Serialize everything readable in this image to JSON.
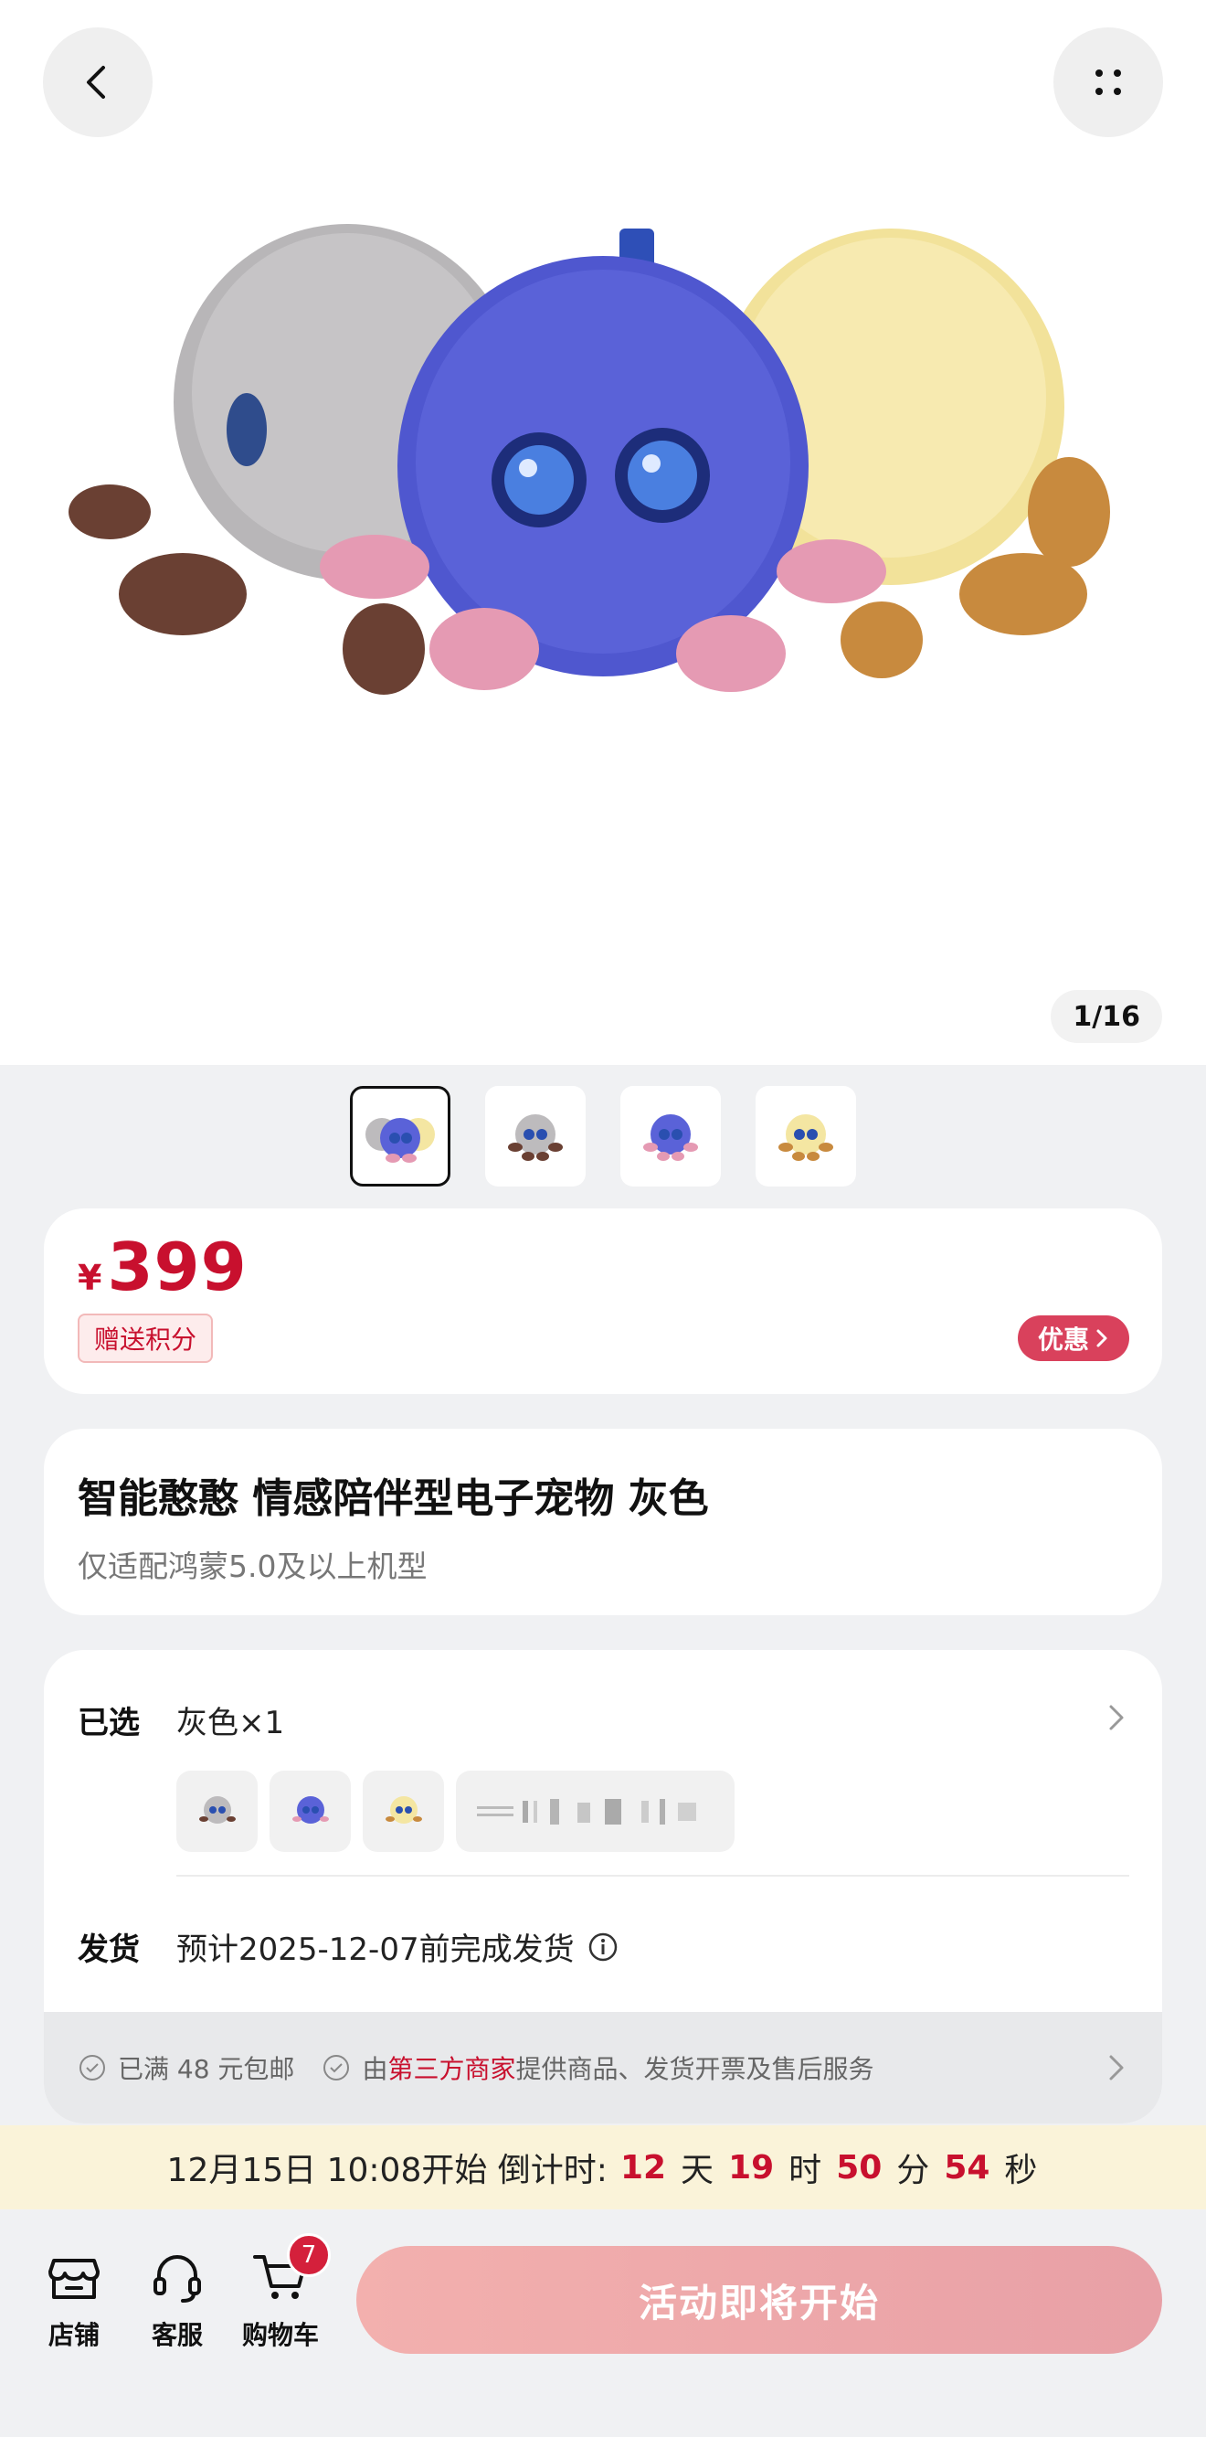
{
  "gallery": {
    "counter": "1/16",
    "thumbnails": [
      "group",
      "gray",
      "blue",
      "yellow"
    ],
    "active_index": 0
  },
  "price": {
    "currency": "¥",
    "amount": "399",
    "points_tag": "赠送积分",
    "discount_label": "优惠"
  },
  "product": {
    "title": "智能憨憨 情感陪伴型电子宠物 灰色",
    "subtitle": "仅适配鸿蒙5.0及以上机型"
  },
  "spec": {
    "selected_label": "已选",
    "selected_value": "灰色×1",
    "shipping_label": "发货",
    "shipping_value": "预计2025-12-07前完成发货"
  },
  "services": {
    "free_shipping": "已满 48 元包邮",
    "seller_prefix": "由",
    "seller_highlight": "第三方商家",
    "seller_suffix": "提供商品、发货开票及售后服务"
  },
  "countdown": {
    "prefix": "12月15日 10:08开始 倒计时:",
    "days": "12",
    "days_unit": "天",
    "hours": "19",
    "hours_unit": "时",
    "minutes": "50",
    "minutes_unit": "分",
    "seconds": "54",
    "seconds_unit": "秒"
  },
  "bottom_bar": {
    "store_label": "店铺",
    "service_label": "客服",
    "cart_label": "购物车",
    "cart_count": "7",
    "cta_label": "活动即将开始"
  },
  "colors": {
    "accent_red": "#c8102e",
    "discount_pill": "#d9415c",
    "cta_gradient_start": "#f3b0ae",
    "cta_gradient_end": "#e8a0a6",
    "countdown_bg": "#faf3d9"
  },
  "icons": {
    "back": "chevron-left-icon",
    "more": "grid-dots-icon",
    "store": "store-icon",
    "service": "headset-icon",
    "cart": "cart-icon",
    "info": "info-icon",
    "check": "check-circle-icon"
  }
}
